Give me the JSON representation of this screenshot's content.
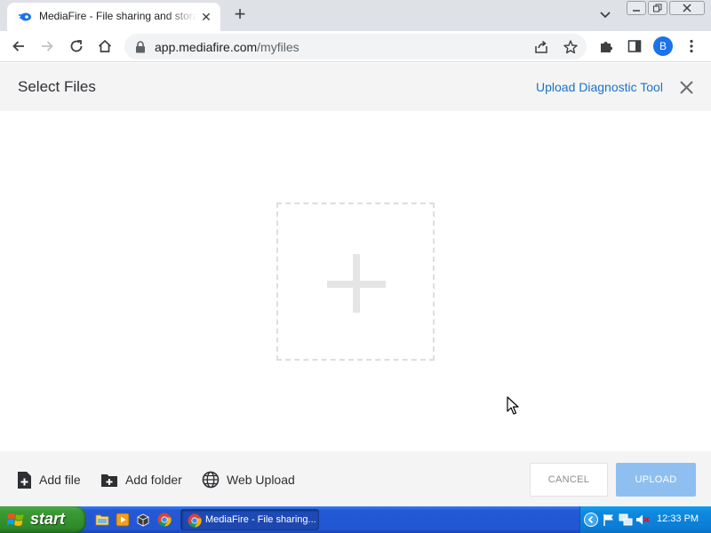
{
  "browser": {
    "tab": {
      "title": "MediaFire - File sharing and storage",
      "favicon": "mediafire-icon"
    },
    "new_tab_icon": "plus-icon",
    "url": {
      "host": "app.mediafire.com",
      "path": "/myfiles"
    },
    "avatar_letter": "B",
    "accent_color": "#1a73e8"
  },
  "dialog": {
    "title": "Select Files",
    "diagnostic_link": "Upload Diagnostic Tool",
    "dropzone_icon": "plus-icon",
    "footer": {
      "add_file": "Add file",
      "add_folder": "Add folder",
      "web_upload": "Web Upload",
      "cancel": "CANCEL",
      "upload": "UPLOAD"
    },
    "colors": {
      "link": "#1a73c8",
      "upload_button": "#8fbff0"
    }
  },
  "taskbar": {
    "start_label": "start",
    "quick_launch": [
      "explorer-icon",
      "media-player-icon",
      "app-icon",
      "chrome-icon"
    ],
    "task_label": "MediaFire - File sharing...",
    "tray_icons": [
      "chevron-left-icon",
      "flag-icon",
      "network-icon",
      "volume-muted-icon"
    ],
    "clock": "12:33 PM"
  }
}
